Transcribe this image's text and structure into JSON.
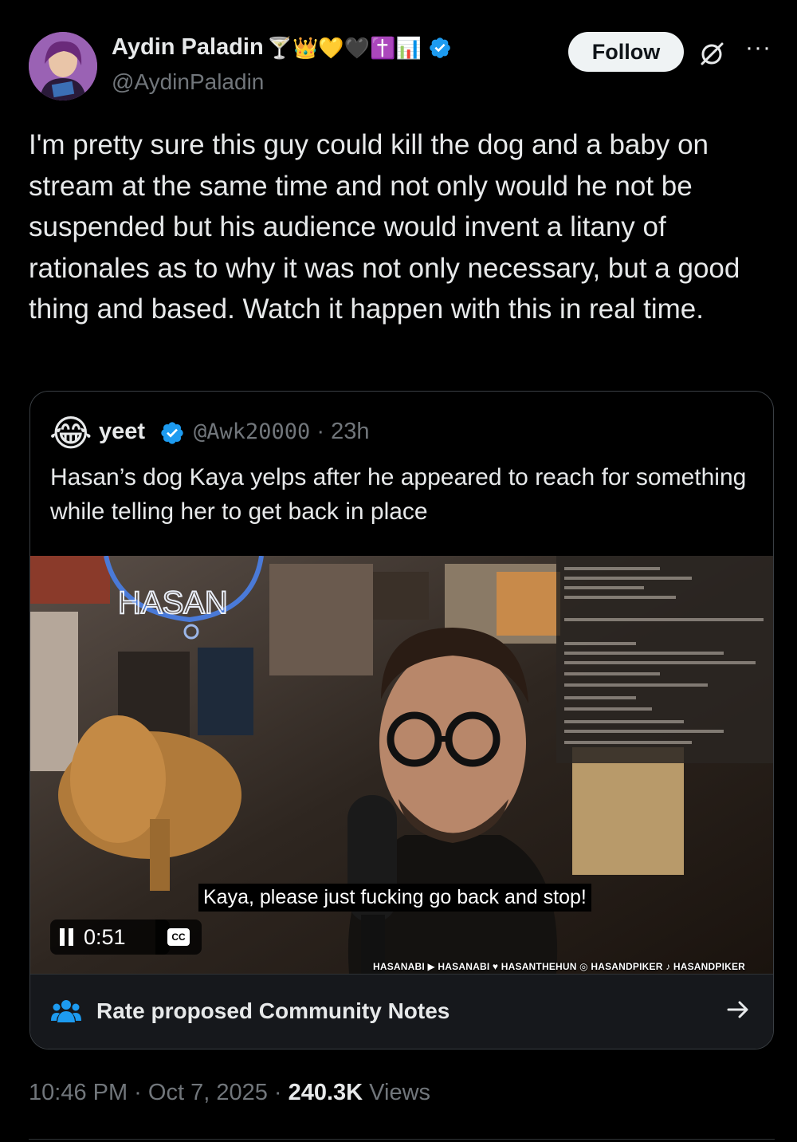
{
  "post": {
    "author_name": "Aydin Paladin",
    "name_emojis": "🍸👑💛🖤✝️📊",
    "handle": "@AydinPaladin",
    "follow_label": "Follow",
    "text": "I'm pretty sure this guy could kill the dog and a baby on stream at the same time and not only would he not be suspended but his audience would invent a litany of rationales as to why it was not only necessary, but a good thing and based. Watch it happen with this in real time.",
    "timestamp": "10:46 PM · Oct 7, 2025 · ",
    "views_count": "240.3K",
    "views_label": " Views"
  },
  "quote": {
    "avatar_emoji": "😂",
    "author_name": "yeet",
    "handle": "@Awk20000",
    "age": " · 23h",
    "text": "Hasan’s dog Kaya yelps after he appeared to reach for something while telling her to get back in place",
    "video": {
      "caption": "Kaya, please just fucking go back and stop!",
      "time": "0:51",
      "cc_label": "CC",
      "neon_sign": "HASAN",
      "socials": "HASANABI ▶ HASANABI ♥ HASANTHEHUN ◎ HASANDPIKER ♪ HASANDPIKER"
    }
  },
  "community_notes": {
    "label": "Rate proposed Community Notes"
  },
  "colors": {
    "background": "#000000",
    "text": "#e7e9ea",
    "muted": "#71767b",
    "verified": "#1d9bf0",
    "follow_bg": "#eff3f4"
  }
}
